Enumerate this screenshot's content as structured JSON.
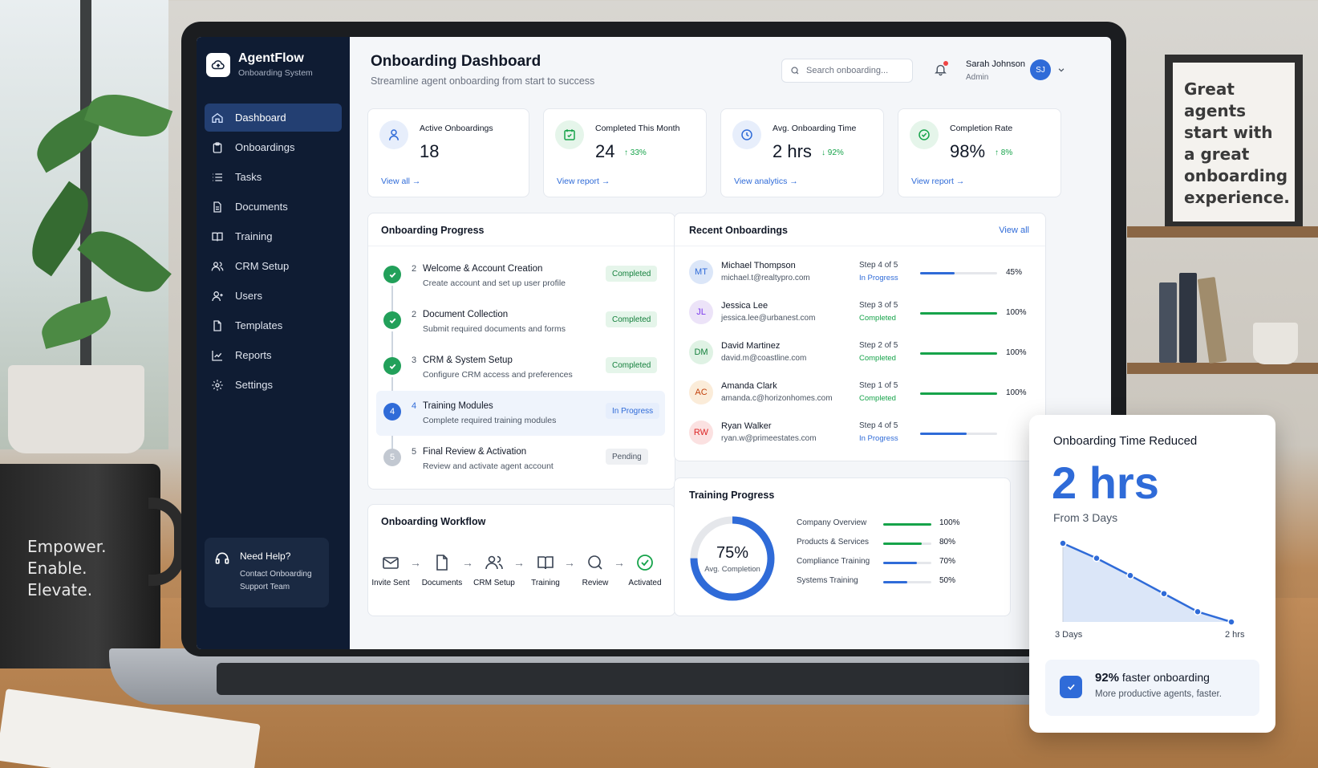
{
  "app": {
    "name": "AgentFlow",
    "subtitle": "Onboarding System"
  },
  "sidebar": {
    "items": [
      {
        "label": "Dashboard",
        "icon": "home-icon",
        "active": true
      },
      {
        "label": "Onboardings",
        "icon": "clipboard-icon"
      },
      {
        "label": "Tasks",
        "icon": "list-icon"
      },
      {
        "label": "Documents",
        "icon": "document-icon"
      },
      {
        "label": "Training",
        "icon": "book-icon"
      },
      {
        "label": "CRM Setup",
        "icon": "users-icon"
      },
      {
        "label": "Users",
        "icon": "user-icon"
      },
      {
        "label": "Templates",
        "icon": "template-icon"
      },
      {
        "label": "Reports",
        "icon": "chart-icon"
      },
      {
        "label": "Settings",
        "icon": "gear-icon"
      }
    ],
    "help": {
      "title": "Need Help?",
      "line1": "Contact Onboarding",
      "line2": "Support Team"
    }
  },
  "header": {
    "title": "Onboarding Dashboard",
    "subtitle": "Streamline agent onboarding from start to success",
    "search_placeholder": "Search onboarding...",
    "user": {
      "name": "Sarah Johnson",
      "role": "Admin",
      "initials": "SJ"
    }
  },
  "stats": [
    {
      "label": "Active Onboardings",
      "value": "18",
      "delta": "",
      "link": "View all →",
      "icon": "user-badge-icon"
    },
    {
      "label": "Completed This Month",
      "value": "24",
      "delta": "↑ 33%",
      "link": "View report →",
      "icon": "calendar-check-icon"
    },
    {
      "label": "Avg. Onboarding Time",
      "value": "2 hrs",
      "delta": "↓ 92%",
      "link": "View analytics →",
      "icon": "clock-icon"
    },
    {
      "label": "Completion Rate",
      "value": "98%",
      "delta": "↑ 8%",
      "link": "View report →",
      "icon": "check-circle-icon"
    }
  ],
  "progress": {
    "title": "Onboarding Progress",
    "steps": [
      {
        "num": "2",
        "title": "Welcome & Account Creation",
        "desc": "Create account and set up user profile",
        "status": "Completed",
        "state": "done"
      },
      {
        "num": "2",
        "title": "Document Collection",
        "desc": "Submit required documents and forms",
        "status": "Completed",
        "state": "done"
      },
      {
        "num": "3",
        "title": "CRM & System Setup",
        "desc": "Configure CRM access and preferences",
        "status": "Completed",
        "state": "done"
      },
      {
        "num": "4",
        "title": "Training Modules",
        "desc": "Complete required training modules",
        "status": "In Progress",
        "state": "prog",
        "circle": "4"
      },
      {
        "num": "5",
        "title": "Final Review & Activation",
        "desc": "Review and activate agent account",
        "status": "Pending",
        "state": "pend",
        "circle": "5"
      }
    ]
  },
  "workflow": {
    "title": "Onboarding Workflow",
    "steps": [
      {
        "label": "Invite Sent",
        "icon": "envelope-icon"
      },
      {
        "label": "Documents",
        "icon": "document-icon"
      },
      {
        "label": "CRM Setup",
        "icon": "users-icon"
      },
      {
        "label": "Training",
        "icon": "book-icon"
      },
      {
        "label": "Review",
        "icon": "search-icon"
      },
      {
        "label": "Activated",
        "icon": "check-circle-icon"
      }
    ]
  },
  "recent": {
    "title": "Recent Onboardings",
    "view_all": "View all",
    "rows": [
      {
        "initials": "MT",
        "name": "Michael Thompson",
        "email": "michael.t@realtypro.com",
        "step": "Step 4 of 5",
        "status": "In Progress",
        "pct": "45%",
        "progress": 0.45,
        "color": "#2f6bd8",
        "avatar_bg": "#dbe6f8",
        "avatar_fg": "#2f6bd8"
      },
      {
        "initials": "JL",
        "name": "Jessica Lee",
        "email": "jessica.lee@urbanest.com",
        "step": "Step 3 of 5",
        "status": "Completed",
        "pct": "100%",
        "progress": 1.0,
        "color": "#16a34a",
        "avatar_bg": "#ece3f8",
        "avatar_fg": "#7c3aed"
      },
      {
        "initials": "DM",
        "name": "David Martinez",
        "email": "david.m@coastline.com",
        "step": "Step 2 of 5",
        "status": "Completed",
        "pct": "100%",
        "progress": 1.0,
        "color": "#16a34a",
        "avatar_bg": "#dff2e4",
        "avatar_fg": "#15803d"
      },
      {
        "initials": "AC",
        "name": "Amanda Clark",
        "email": "amanda.c@horizonhomes.com",
        "step": "Step 1 of 5",
        "status": "Completed",
        "pct": "100%",
        "progress": 1.0,
        "color": "#16a34a",
        "avatar_bg": "#fbecd9",
        "avatar_fg": "#c2410c"
      },
      {
        "initials": "RW",
        "name": "Ryan Walker",
        "email": "ryan.w@primeestates.com",
        "step": "Step 4 of 5",
        "status": "In Progress",
        "pct": "",
        "progress": 0.6,
        "color": "#2f6bd8",
        "avatar_bg": "#fbe1e1",
        "avatar_fg": "#dc2626"
      }
    ]
  },
  "training": {
    "title": "Training Progress",
    "avg_value": "75%",
    "avg_label": "Avg. Completion",
    "avg_progress": 0.75,
    "items": [
      {
        "label": "Company Overview",
        "pct": "100%",
        "progress": 1.0,
        "color": "#16a34a"
      },
      {
        "label": "Products & Services",
        "pct": "80%",
        "progress": 0.8,
        "color": "#16a34a"
      },
      {
        "label": "Compliance Training",
        "pct": "70%",
        "progress": 0.7,
        "color": "#2f6bd8"
      },
      {
        "label": "Systems Training",
        "pct": "50%",
        "progress": 0.5,
        "color": "#2f6bd8"
      }
    ]
  },
  "highlight": {
    "title": "Onboarding Time Reduced",
    "value": "2 hrs",
    "from": "From 3 Days",
    "footer_pct": "92%",
    "footer_title": "faster onboarding",
    "footer_sub": "More productive agents, faster."
  },
  "chart_data": {
    "type": "line",
    "x": [
      "3 Days",
      "",
      "",
      "",
      "",
      "2 hrs"
    ],
    "series": [
      {
        "values": [
          1.0,
          0.81,
          0.59,
          0.36,
          0.13,
          0.0
        ]
      }
    ],
    "xlabel": "",
    "ylabel": "",
    "grid": false,
    "fill": true
  },
  "scene": {
    "mug_lines": [
      "Empower.",
      "Enable.",
      "Elevate."
    ],
    "poster_lines": [
      "Great agents",
      "start with",
      "a great",
      "onboarding",
      "experience."
    ]
  },
  "colors": {
    "accent": "#2f6bd8",
    "success": "#16a34a",
    "sidebar": "#0f1c33"
  }
}
